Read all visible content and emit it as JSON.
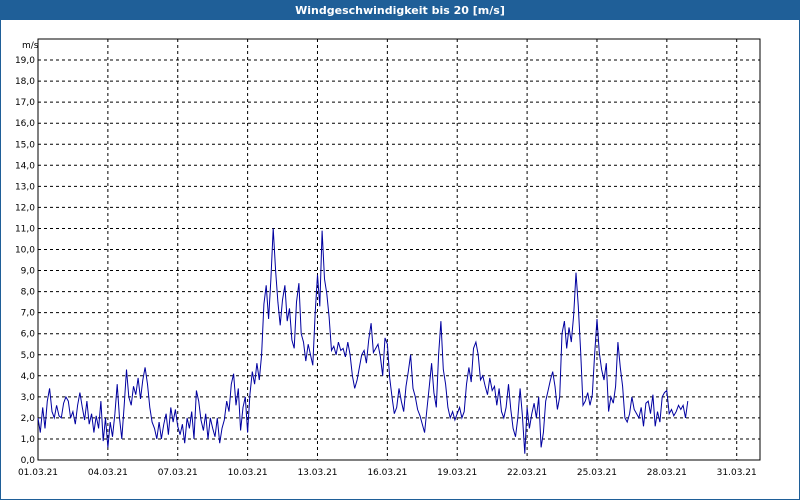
{
  "window": {
    "title": "Windgeschwindigkeit bis 20 [m/s]"
  },
  "chart_data": {
    "type": "line",
    "title": "Windgeschwindigkeit bis 20 [m/s]",
    "ylabel": "m/s",
    "xlabel": "",
    "ylim": [
      0,
      20
    ],
    "xlim": [
      0,
      31
    ],
    "grid": true,
    "y_ticks": [
      "0,0",
      "1,0",
      "2,0",
      "3,0",
      "4,0",
      "5,0",
      "6,0",
      "7,0",
      "8,0",
      "9,0",
      "10,0",
      "11,0",
      "12,0",
      "13,0",
      "14,0",
      "15,0",
      "16,0",
      "17,0",
      "18,0",
      "19,0"
    ],
    "x_ticks": [
      {
        "label": "01.03.21",
        "day": 0
      },
      {
        "label": "04.03.21",
        "day": 3
      },
      {
        "label": "07.03.21",
        "day": 6
      },
      {
        "label": "10.03.21",
        "day": 9
      },
      {
        "label": "13.03.21",
        "day": 12
      },
      {
        "label": "16.03.21",
        "day": 15
      },
      {
        "label": "19.03.21",
        "day": 18
      },
      {
        "label": "22.03.21",
        "day": 21
      },
      {
        "label": "25.03.21",
        "day": 24
      },
      {
        "label": "28.03.21",
        "day": 27
      },
      {
        "label": "31.03.21",
        "day": 30
      }
    ],
    "series": [
      {
        "color": "#0000a0",
        "points": [
          [
            0.0,
            2.0
          ],
          [
            0.1,
            1.3
          ],
          [
            0.2,
            2.5
          ],
          [
            0.3,
            1.5
          ],
          [
            0.4,
            2.8
          ],
          [
            0.5,
            3.4
          ],
          [
            0.6,
            2.3
          ],
          [
            0.7,
            2.0
          ],
          [
            0.8,
            2.6
          ],
          [
            0.9,
            2.1
          ],
          [
            1.0,
            2.0
          ],
          [
            1.1,
            2.7
          ],
          [
            1.2,
            3.0
          ],
          [
            1.3,
            2.8
          ],
          [
            1.4,
            2.0
          ],
          [
            1.5,
            2.3
          ],
          [
            1.6,
            1.7
          ],
          [
            1.7,
            2.6
          ],
          [
            1.8,
            3.2
          ],
          [
            1.9,
            2.5
          ],
          [
            2.0,
            1.9
          ],
          [
            2.1,
            2.8
          ],
          [
            2.2,
            1.7
          ],
          [
            2.3,
            2.2
          ],
          [
            2.4,
            1.3
          ],
          [
            2.5,
            2.1
          ],
          [
            2.6,
            1.5
          ],
          [
            2.7,
            2.8
          ],
          [
            2.8,
            0.9
          ],
          [
            2.9,
            2.0
          ],
          [
            3.0,
            0.6
          ],
          [
            3.1,
            1.8
          ],
          [
            3.2,
            1.1
          ],
          [
            3.3,
            2.2
          ],
          [
            3.4,
            3.6
          ],
          [
            3.5,
            2.0
          ],
          [
            3.6,
            1.0
          ],
          [
            3.7,
            2.6
          ],
          [
            3.8,
            4.3
          ],
          [
            3.9,
            3.0
          ],
          [
            4.0,
            2.6
          ],
          [
            4.1,
            3.5
          ],
          [
            4.2,
            3.1
          ],
          [
            4.3,
            3.9
          ],
          [
            4.4,
            2.9
          ],
          [
            4.5,
            3.8
          ],
          [
            4.6,
            4.4
          ],
          [
            4.7,
            3.6
          ],
          [
            4.8,
            2.5
          ],
          [
            4.9,
            1.8
          ],
          [
            5.0,
            1.5
          ],
          [
            5.1,
            1.0
          ],
          [
            5.2,
            1.8
          ],
          [
            5.3,
            1.0
          ],
          [
            5.4,
            1.7
          ],
          [
            5.5,
            2.2
          ],
          [
            5.6,
            1.2
          ],
          [
            5.7,
            2.5
          ],
          [
            5.8,
            1.8
          ],
          [
            5.9,
            2.4
          ],
          [
            6.0,
            1.6
          ],
          [
            6.1,
            1.2
          ],
          [
            6.2,
            1.7
          ],
          [
            6.3,
            0.8
          ],
          [
            6.4,
            2.0
          ],
          [
            6.5,
            1.5
          ],
          [
            6.6,
            2.3
          ],
          [
            6.7,
            1.0
          ],
          [
            6.8,
            3.3
          ],
          [
            6.9,
            2.8
          ],
          [
            7.0,
            1.9
          ],
          [
            7.1,
            1.4
          ],
          [
            7.2,
            2.2
          ],
          [
            7.3,
            1.0
          ],
          [
            7.4,
            2.0
          ],
          [
            7.5,
            1.5
          ],
          [
            7.6,
            1.1
          ],
          [
            7.7,
            2.0
          ],
          [
            7.8,
            0.8
          ],
          [
            7.9,
            1.5
          ],
          [
            8.0,
            1.9
          ],
          [
            8.1,
            2.8
          ],
          [
            8.2,
            2.3
          ],
          [
            8.3,
            3.6
          ],
          [
            8.4,
            4.1
          ],
          [
            8.5,
            2.6
          ],
          [
            8.6,
            3.4
          ],
          [
            8.7,
            1.4
          ],
          [
            8.8,
            2.5
          ],
          [
            8.9,
            3.0
          ],
          [
            9.0,
            1.3
          ],
          [
            9.1,
            3.1
          ],
          [
            9.2,
            4.2
          ],
          [
            9.3,
            3.6
          ],
          [
            9.4,
            4.6
          ],
          [
            9.5,
            3.8
          ],
          [
            9.6,
            5.0
          ],
          [
            9.7,
            7.4
          ],
          [
            9.8,
            8.3
          ],
          [
            9.9,
            6.7
          ],
          [
            10.0,
            8.6
          ],
          [
            10.1,
            11.0
          ],
          [
            10.2,
            9.0
          ],
          [
            10.3,
            7.5
          ],
          [
            10.4,
            6.4
          ],
          [
            10.5,
            7.6
          ],
          [
            10.6,
            8.3
          ],
          [
            10.7,
            6.6
          ],
          [
            10.8,
            7.2
          ],
          [
            10.9,
            5.7
          ],
          [
            11.0,
            5.3
          ],
          [
            11.1,
            7.5
          ],
          [
            11.2,
            8.4
          ],
          [
            11.3,
            6.0
          ],
          [
            11.4,
            5.6
          ],
          [
            11.5,
            4.7
          ],
          [
            11.6,
            5.5
          ],
          [
            11.7,
            5.0
          ],
          [
            11.8,
            4.5
          ],
          [
            11.9,
            7.0
          ],
          [
            12.0,
            8.8
          ],
          [
            12.1,
            7.3
          ],
          [
            12.2,
            10.9
          ],
          [
            12.3,
            8.6
          ],
          [
            12.4,
            7.9
          ],
          [
            12.5,
            6.8
          ],
          [
            12.6,
            5.2
          ],
          [
            12.7,
            5.4
          ],
          [
            12.8,
            5.0
          ],
          [
            12.9,
            5.6
          ],
          [
            13.0,
            5.2
          ],
          [
            13.1,
            5.3
          ],
          [
            13.2,
            4.9
          ],
          [
            13.3,
            5.6
          ],
          [
            13.4,
            5.0
          ],
          [
            13.5,
            4.0
          ],
          [
            13.6,
            3.4
          ],
          [
            13.7,
            3.8
          ],
          [
            13.8,
            4.4
          ],
          [
            13.9,
            5.0
          ],
          [
            14.0,
            5.2
          ],
          [
            14.1,
            4.6
          ],
          [
            14.2,
            5.7
          ],
          [
            14.3,
            6.5
          ],
          [
            14.4,
            5.1
          ],
          [
            14.5,
            5.3
          ],
          [
            14.6,
            5.5
          ],
          [
            14.7,
            4.9
          ],
          [
            14.8,
            4.0
          ],
          [
            14.9,
            5.8
          ],
          [
            15.0,
            5.5
          ],
          [
            15.1,
            3.9
          ],
          [
            15.2,
            3.0
          ],
          [
            15.3,
            2.2
          ],
          [
            15.4,
            2.5
          ],
          [
            15.5,
            3.4
          ],
          [
            15.6,
            2.8
          ],
          [
            15.7,
            2.3
          ],
          [
            15.8,
            3.5
          ],
          [
            15.9,
            4.2
          ],
          [
            16.0,
            5.0
          ],
          [
            16.1,
            3.4
          ],
          [
            16.2,
            3.0
          ],
          [
            16.3,
            2.4
          ],
          [
            16.4,
            2.1
          ],
          [
            16.5,
            1.7
          ],
          [
            16.6,
            1.3
          ],
          [
            16.7,
            2.4
          ],
          [
            16.8,
            3.5
          ],
          [
            16.9,
            4.6
          ],
          [
            17.0,
            3.2
          ],
          [
            17.1,
            2.5
          ],
          [
            17.2,
            5.0
          ],
          [
            17.3,
            6.6
          ],
          [
            17.4,
            4.3
          ],
          [
            17.5,
            3.6
          ],
          [
            17.6,
            2.5
          ],
          [
            17.7,
            2.0
          ],
          [
            17.8,
            2.3
          ],
          [
            17.9,
            1.9
          ],
          [
            18.0,
            2.2
          ],
          [
            18.1,
            2.5
          ],
          [
            18.2,
            2.0
          ],
          [
            18.3,
            2.3
          ],
          [
            18.4,
            3.6
          ],
          [
            18.5,
            4.4
          ],
          [
            18.6,
            3.7
          ],
          [
            18.7,
            5.3
          ],
          [
            18.8,
            5.6
          ],
          [
            18.9,
            5.0
          ],
          [
            19.0,
            3.8
          ],
          [
            19.1,
            4.0
          ],
          [
            19.2,
            3.5
          ],
          [
            19.3,
            3.1
          ],
          [
            19.4,
            3.9
          ],
          [
            19.5,
            3.3
          ],
          [
            19.6,
            3.5
          ],
          [
            19.7,
            2.6
          ],
          [
            19.8,
            3.4
          ],
          [
            19.9,
            2.3
          ],
          [
            20.0,
            2.0
          ],
          [
            20.1,
            2.5
          ],
          [
            20.2,
            3.6
          ],
          [
            20.3,
            2.4
          ],
          [
            20.4,
            1.5
          ],
          [
            20.5,
            1.1
          ],
          [
            20.6,
            2.0
          ],
          [
            20.7,
            3.4
          ],
          [
            20.8,
            2.1
          ],
          [
            20.9,
            0.3
          ],
          [
            21.0,
            2.5
          ],
          [
            21.1,
            1.5
          ],
          [
            21.2,
            2.2
          ],
          [
            21.3,
            2.7
          ],
          [
            21.4,
            2.0
          ],
          [
            21.5,
            3.0
          ],
          [
            21.6,
            0.6
          ],
          [
            21.7,
            1.3
          ],
          [
            21.8,
            2.8
          ],
          [
            21.9,
            3.3
          ],
          [
            22.0,
            3.8
          ],
          [
            22.1,
            4.2
          ],
          [
            22.2,
            3.5
          ],
          [
            22.3,
            2.4
          ],
          [
            22.4,
            3.0
          ],
          [
            22.5,
            6.0
          ],
          [
            22.6,
            6.6
          ],
          [
            22.7,
            5.3
          ],
          [
            22.8,
            6.3
          ],
          [
            22.9,
            5.6
          ],
          [
            23.0,
            6.9
          ],
          [
            23.1,
            8.9
          ],
          [
            23.2,
            7.3
          ],
          [
            23.3,
            5.1
          ],
          [
            23.4,
            2.6
          ],
          [
            23.5,
            2.8
          ],
          [
            23.6,
            3.2
          ],
          [
            23.7,
            2.6
          ],
          [
            23.8,
            3.1
          ],
          [
            23.9,
            5.0
          ],
          [
            24.0,
            6.7
          ],
          [
            24.1,
            5.1
          ],
          [
            24.2,
            4.3
          ],
          [
            24.3,
            3.8
          ],
          [
            24.4,
            4.6
          ],
          [
            24.5,
            2.3
          ],
          [
            24.6,
            3.0
          ],
          [
            24.7,
            2.7
          ],
          [
            24.8,
            3.5
          ],
          [
            24.9,
            5.6
          ],
          [
            25.0,
            4.4
          ],
          [
            25.1,
            3.5
          ],
          [
            25.2,
            2.0
          ],
          [
            25.3,
            1.8
          ],
          [
            25.4,
            2.2
          ],
          [
            25.5,
            3.0
          ],
          [
            25.6,
            2.4
          ],
          [
            25.7,
            2.2
          ],
          [
            25.8,
            2.0
          ],
          [
            25.9,
            2.5
          ],
          [
            26.0,
            1.6
          ],
          [
            26.1,
            2.7
          ],
          [
            26.2,
            2.8
          ],
          [
            26.3,
            2.2
          ],
          [
            26.4,
            3.1
          ],
          [
            26.5,
            1.6
          ],
          [
            26.6,
            2.3
          ],
          [
            26.7,
            1.8
          ],
          [
            26.8,
            3.0
          ],
          [
            26.9,
            3.2
          ],
          [
            27.0,
            3.3
          ],
          [
            27.1,
            2.2
          ],
          [
            27.2,
            2.4
          ],
          [
            27.3,
            2.1
          ],
          [
            27.4,
            2.3
          ],
          [
            27.5,
            2.6
          ],
          [
            27.6,
            2.4
          ],
          [
            27.7,
            2.6
          ],
          [
            27.8,
            2.0
          ],
          [
            27.9,
            2.8
          ]
        ]
      }
    ]
  }
}
